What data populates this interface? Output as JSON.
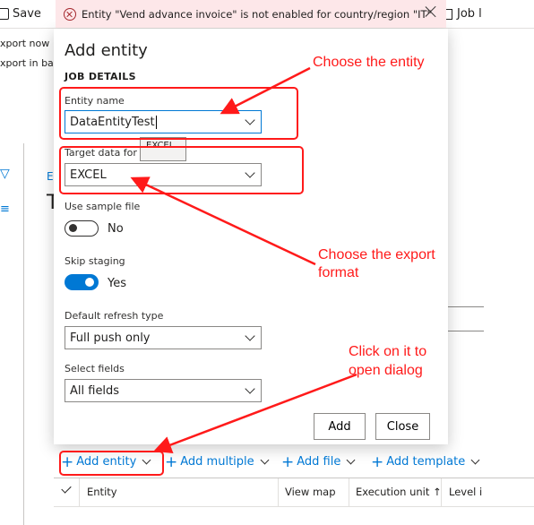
{
  "background": {
    "save_label": "Save",
    "job_label": "Job l",
    "menu_export_now": "xport now",
    "menu_export_batch": "xport in bat",
    "ex_link": "Ex",
    "t_heading": "T"
  },
  "error_bar": {
    "message": "Entity \"Vend advance invoice\" is not enabled for country/region \"IT\""
  },
  "dialog": {
    "title": "Add entity",
    "section": "JOB DETAILS",
    "entity_name": {
      "label": "Entity name",
      "value": "DataEntityTest"
    },
    "target_format": {
      "label": "Target data for",
      "value": "EXCEL",
      "tooltip": "EXCEL"
    },
    "sample_file": {
      "label": "Use sample file",
      "state": "No"
    },
    "skip_staging": {
      "label": "Skip staging",
      "state": "Yes"
    },
    "refresh_type": {
      "label": "Default refresh type",
      "value": "Full push only"
    },
    "select_fields": {
      "label": "Select fields",
      "value": "All fields"
    },
    "add_button": "Add",
    "close_button": "Close"
  },
  "toolbar": {
    "add_entity": "Add entity",
    "add_multiple": "Add multiple",
    "add_file": "Add file",
    "add_template": "Add template"
  },
  "grid": {
    "columns": [
      "Entity",
      "View map",
      "Execution unit",
      "Level i"
    ],
    "sort_arrow": "↑"
  },
  "annotations": {
    "choose_entity": "Choose the entity",
    "choose_format_line1": "Choose the export",
    "choose_format_line2": "format",
    "click_line1": "Click on it to",
    "click_line2": "open dialog",
    "color": "#ff1a1a"
  },
  "colors": {
    "accent": "#0078d4",
    "error_bg": "#fde7e9",
    "error_icon": "#a4262c"
  }
}
